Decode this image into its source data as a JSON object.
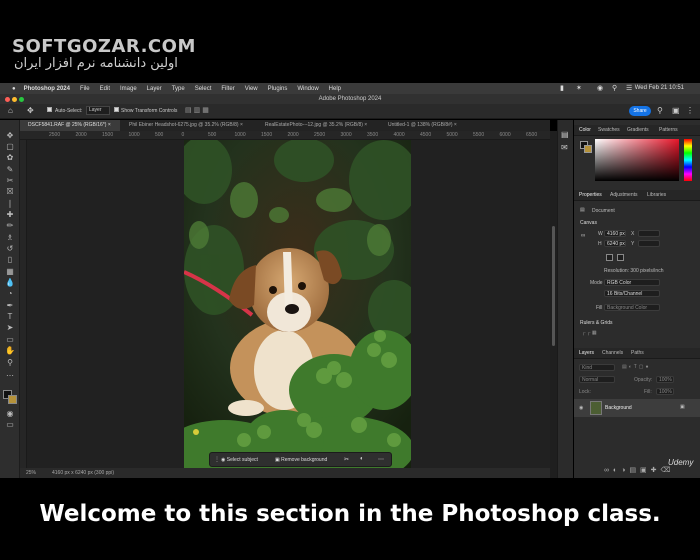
{
  "watermark": {
    "brand": "SOFTGOZAR.COM",
    "tagline": "اولین دانشنامه نرم افزار ایران"
  },
  "menubar": {
    "app": "Photoshop 2024",
    "items": [
      "File",
      "Edit",
      "Image",
      "Layer",
      "Type",
      "Select",
      "Filter",
      "View",
      "Plugins",
      "Window",
      "Help"
    ],
    "clock": "Wed Feb 21  10:51"
  },
  "window": {
    "title": "Adobe Photoshop 2024",
    "share_label": "Share"
  },
  "options": {
    "auto_select": "Auto-Select:",
    "layer_select": "Layer",
    "transform_controls": "Show Transform Controls"
  },
  "tabs": [
    {
      "label": "DSCF5841.RAF @ 25% (RGB/16*) ×"
    },
    {
      "label": "Phil Ebiner Headshot-6275.jpg @ 35.2% (RGB/8) ×"
    },
    {
      "label": "RealEstatePhoto---12.jpg @ 35.2% (RGB/8) ×"
    },
    {
      "label": "Untitled-1 @ 138% (RGB/8#) ×"
    }
  ],
  "ruler_ticks": [
    "2500",
    "2000",
    "1500",
    "1000",
    "500",
    "0",
    "500",
    "1000",
    "1500",
    "2000",
    "2500",
    "3000",
    "3500",
    "4000",
    "4500",
    "5000",
    "5500",
    "6000",
    "6500"
  ],
  "context_bar": {
    "select_subject": "Select subject",
    "remove_background": "Remove background"
  },
  "status": {
    "zoom": "25%",
    "doc_info": "4160 px x 6240 px (300 ppi)"
  },
  "color_panel": {
    "tabs": [
      "Color",
      "Swatches",
      "Gradients",
      "Patterns"
    ],
    "accent": "#e8162a"
  },
  "properties": {
    "tabs": [
      "Properties",
      "Adjustments",
      "Libraries"
    ],
    "doc_label": "Document",
    "canvas_heading": "Canvas",
    "w_label": "W",
    "w_value": "4160 px",
    "x_label": "X",
    "h_label": "H",
    "h_value": "6240 px",
    "y_label": "Y",
    "resolution": "Resolution: 300 pixels/inch",
    "mode_label": "Mode",
    "mode_value": "RGB Color",
    "depth_value": "16 Bits/Channel",
    "fill_label": "Fill",
    "fill_value": "Background Color",
    "rulers_heading": "Rulers & Grids"
  },
  "layers": {
    "tabs": [
      "Layers",
      "Channels",
      "Paths"
    ],
    "kind_placeholder": "Kind",
    "blend_mode": "Normal",
    "opacity_label": "Opacity:",
    "opacity_value": "100%",
    "lock_label": "Lock:",
    "fill_label": "Fill:",
    "fill_value": "100%",
    "items": [
      {
        "name": "Background"
      }
    ]
  },
  "logo": "Udemy",
  "caption": "Welcome to this section in the Photoshop class."
}
